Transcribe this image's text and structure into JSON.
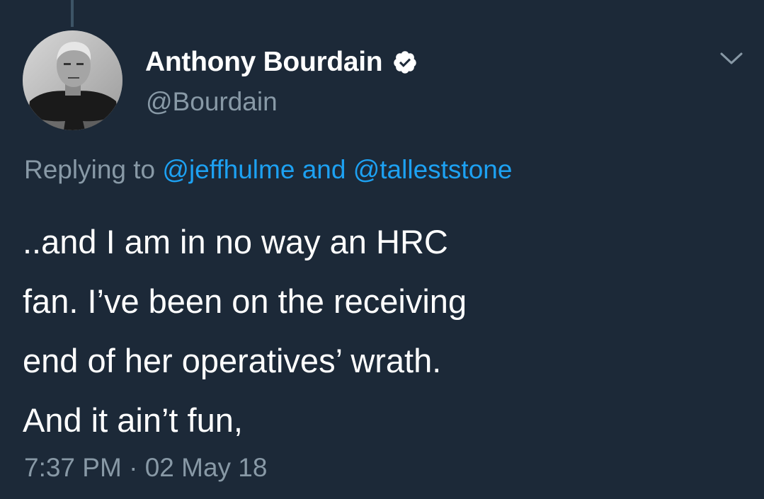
{
  "tweet": {
    "author": {
      "display_name": "Anthony Bourdain",
      "handle": "@Bourdain",
      "verified": true,
      "avatar_icon": "avatar-photo"
    },
    "reply": {
      "prefix": "Replying to",
      "mention_1": "@jeffhulme",
      "conjunction": "and",
      "mention_2": "@talleststone"
    },
    "text_lines": [
      "..and I am in no way an HRC",
      "fan. I’ve been on the receiving",
      "end of her operatives’ wrath.",
      "And it ain’t fun,"
    ],
    "time": "7:37 PM",
    "separator": "·",
    "date": "02 May 18"
  },
  "colors": {
    "background": "#1c2938",
    "primary_text": "#ffffff",
    "secondary_text": "#8899a6",
    "link": "#1da1f2"
  },
  "icons": {
    "verified": "verified-badge-icon",
    "menu": "chevron-down-icon"
  }
}
